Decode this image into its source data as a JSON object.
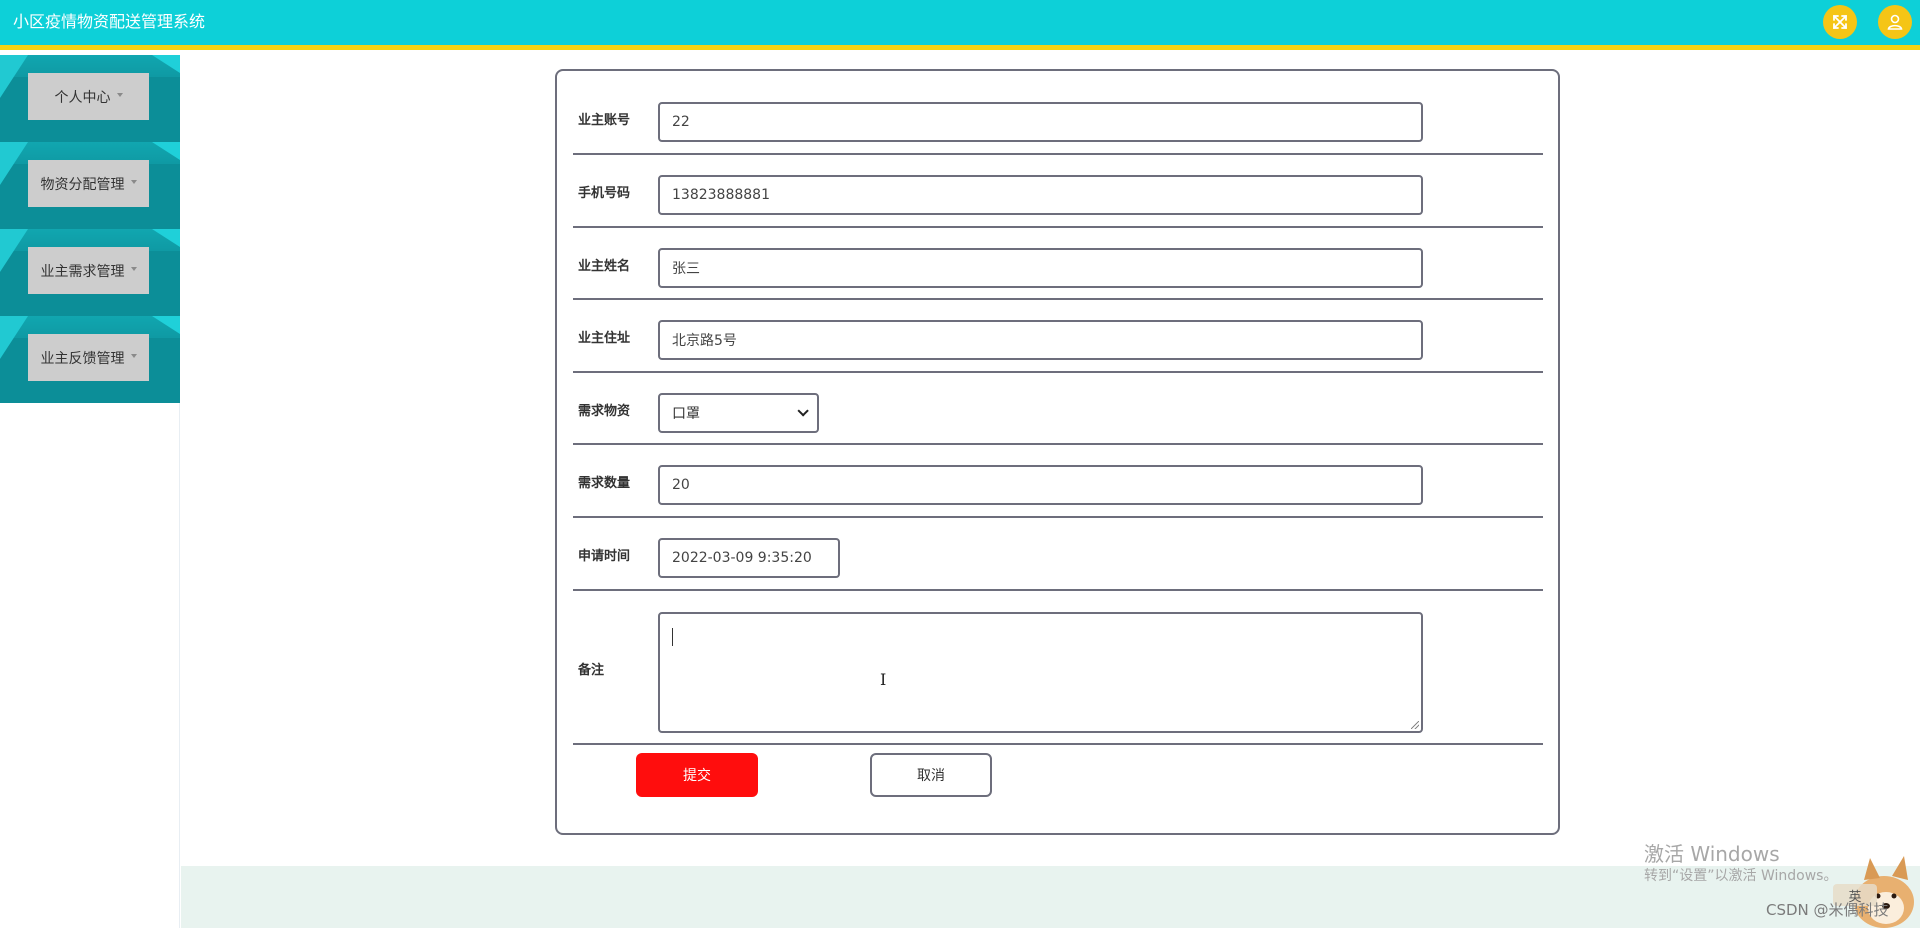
{
  "header": {
    "title": "小区疫情物资配送管理系统",
    "accent_color": "#0dd0d8",
    "underline_color": "#f5d312",
    "icons": [
      "fullscreen-icon",
      "user-icon"
    ]
  },
  "sidebar": {
    "items": [
      {
        "label": "个人中心"
      },
      {
        "label": "物资分配管理"
      },
      {
        "label": "业主需求管理"
      },
      {
        "label": "业主反馈管理"
      }
    ]
  },
  "form": {
    "fields": [
      {
        "label": "业主账号",
        "value": "22"
      },
      {
        "label": "手机号码",
        "value": "13823888881"
      },
      {
        "label": "业主姓名",
        "value": "张三"
      },
      {
        "label": "业主住址",
        "value": "北京路5号"
      },
      {
        "label": "需求物资",
        "value": "口罩"
      },
      {
        "label": "需求数量",
        "value": "20"
      },
      {
        "label": "申请时间",
        "value": "2022-03-09 9:35:20"
      },
      {
        "label": "备注",
        "value": ""
      }
    ],
    "submit_label": "提交",
    "cancel_label": "取消",
    "submit_color": "#ff0d0d"
  },
  "watermarks": {
    "windows_line1": "激活 Windows",
    "windows_line2": "转到“设置”以激活 Windows。",
    "ime_badge": "英",
    "csdn": "CSDN @米偶科技"
  }
}
